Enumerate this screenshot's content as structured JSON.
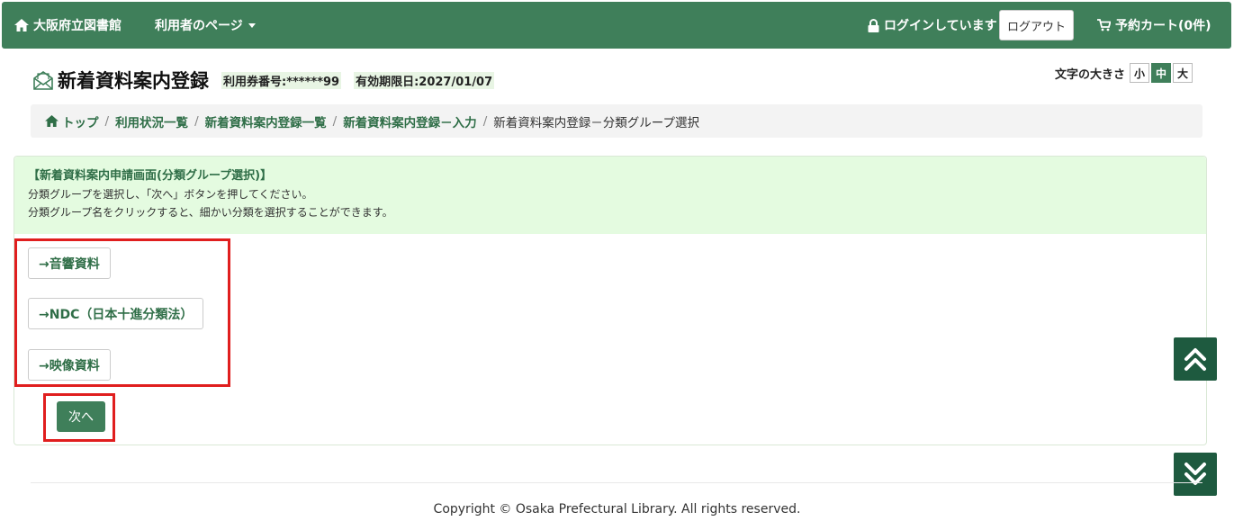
{
  "navbar": {
    "library_name": "大阪府立図書館",
    "user_menu": "利用者のページ",
    "login_status": "ログインしています",
    "logout": "ログアウト",
    "cart": "予約カート(0件)"
  },
  "header": {
    "title": "新着資料案内登録",
    "card_number": "利用券番号:******99",
    "expiry": "有効期限日:2027/01/07",
    "font_size_label": "文字の大きさ",
    "font_sizes": [
      "小",
      "中",
      "大"
    ],
    "font_size_selected": "中"
  },
  "breadcrumb": {
    "items": [
      "トップ",
      "利用状況一覧",
      "新着資料案内登録一覧",
      "新着資料案内登録－入力"
    ],
    "current": "新着資料案内登録－分類グループ選択"
  },
  "panel": {
    "title": "【新着資料案内申請画面(分類グループ選択)】",
    "line1": "分類グループを選択し、「次へ」ボタンを押してください。",
    "line2": "分類グループ名をクリックすると、細かい分類を選択することができます。",
    "groups": [
      "→音響資料",
      "→NDC（日本十進分類法）",
      "→映像資料"
    ],
    "next": "次へ"
  },
  "footer": {
    "copyright": "Copyright © Osaka Prefectural Library. All rights reserved."
  },
  "colors": {
    "brand_green": "#3f7f5a",
    "dark_green": "#1e5a3f",
    "highlight_red": "#e01e1e",
    "panel_head": "#e4fbe0"
  }
}
